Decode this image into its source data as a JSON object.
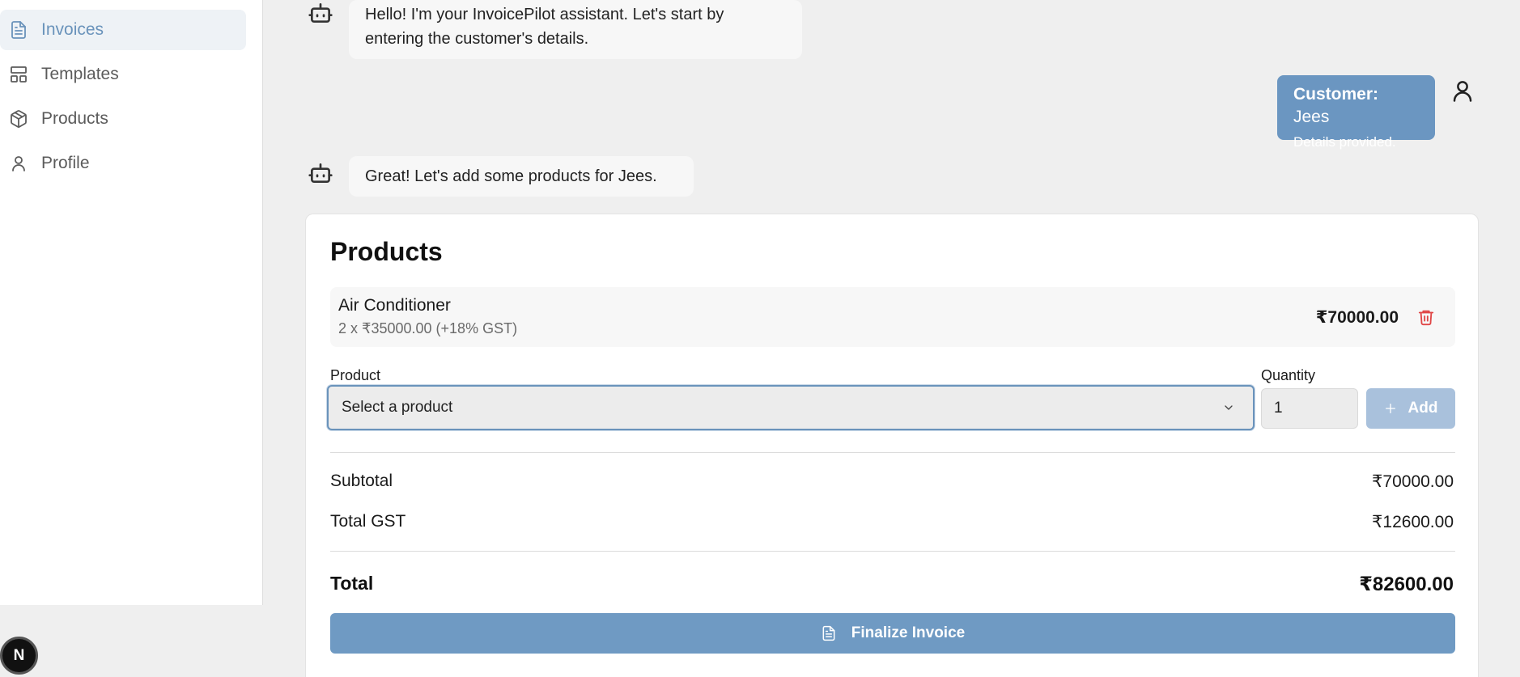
{
  "sidebar": {
    "items": [
      {
        "label": "Invoices",
        "icon": "file-text-icon",
        "active": true
      },
      {
        "label": "Templates",
        "icon": "layout-icon"
      },
      {
        "label": "Products",
        "icon": "package-icon"
      },
      {
        "label": "Profile",
        "icon": "user-icon"
      }
    ]
  },
  "badge": {
    "letter": "N"
  },
  "chat": {
    "bot_message_1": [
      "Hello! I'm your InvoicePilot assistant. Let's start by",
      "entering the customer's details."
    ],
    "user_message": {
      "customer_label": "Customer:",
      "customer_name": "Jees",
      "details": "Details provided."
    },
    "bot_message_2": "Great! Let's add some products for Jees."
  },
  "products": {
    "title": "Products",
    "items": [
      {
        "name": "Air Conditioner",
        "detail": "2 x ₹35000.00 (+18% GST)",
        "amount": "₹70000.00"
      }
    ],
    "product_label": "Product",
    "product_placeholder": "Select a product",
    "quantity_label": "Quantity",
    "quantity_value": "1",
    "add_label": "Add",
    "subtotal_label": "Subtotal",
    "subtotal_value": "₹70000.00",
    "gst_label": "Total GST",
    "gst_value": "₹12600.00",
    "total_label": "Total",
    "total_value": "₹82600.00",
    "finalize_label": "Finalize Invoice"
  },
  "colors": {
    "accent": "#6f9ac3",
    "danger": "#e04646",
    "active_nav": "#6a93bb"
  }
}
